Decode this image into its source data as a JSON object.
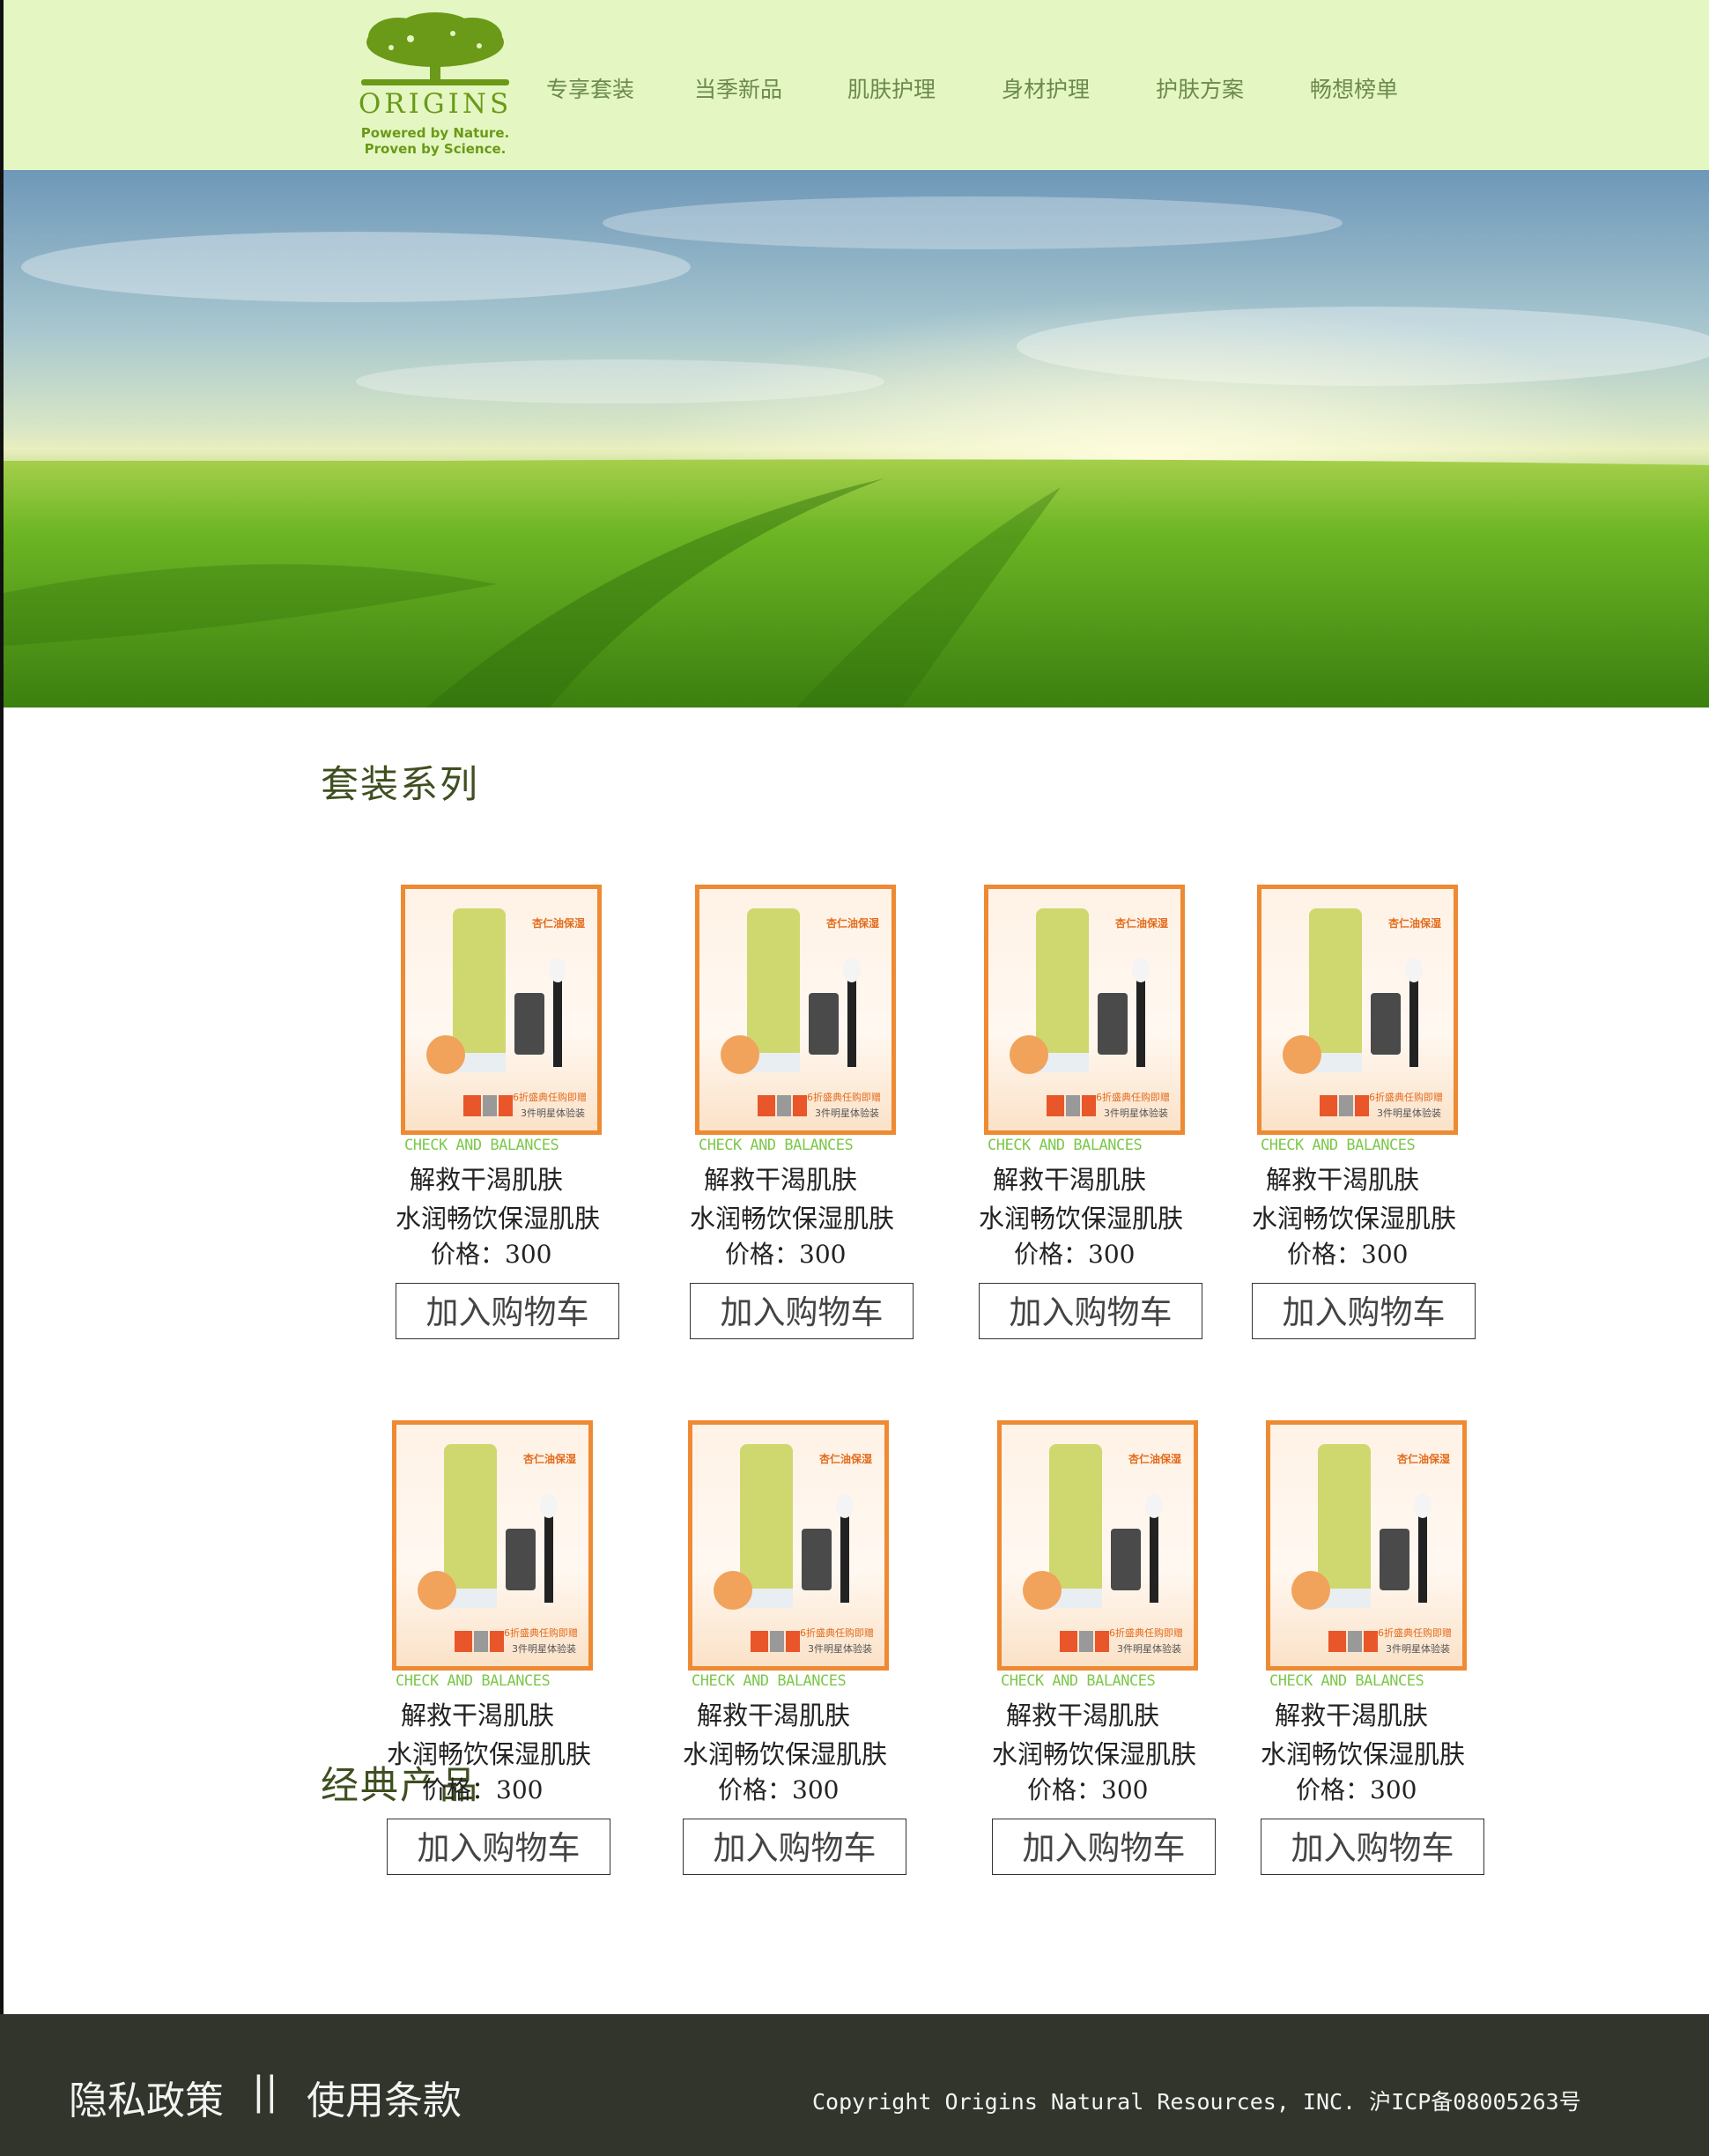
{
  "header": {
    "logo_word": "ORIGINS",
    "logo_tag1": "Powered by Nature.",
    "logo_tag2": "Proven by Science.",
    "nav": [
      "专享套装",
      "当季新品",
      "肌肤护理",
      "身材护理",
      "护肤方案",
      "畅想榜单"
    ]
  },
  "sections": {
    "sets_title": "套装系列",
    "classic_title": "经典产品"
  },
  "product": {
    "promo_top": "杏仁油保湿",
    "promo_bot1": "6折盛典任购即赠",
    "promo_bot2": "3件明星体验装",
    "brand_line": "CHECK AND BALANCES",
    "name1": "解救干渴肌肤",
    "name2": "水润畅饮保湿肌肤",
    "price": "价格：300",
    "cart": "加入购物车"
  },
  "footer": {
    "privacy": "隐私政策",
    "separator": "||",
    "terms": "使用条款",
    "copyright": "Copyright Origins Natural Resources, INC. 沪ICP备08005263号"
  },
  "colors": {
    "header_bg": "#e4f7c3",
    "brand_green": "#6a9a17",
    "nav_text": "#6c8a4d",
    "product_border": "#ee8a33",
    "brand_line": "#7dc84b",
    "footer_bg": "#31352b"
  }
}
